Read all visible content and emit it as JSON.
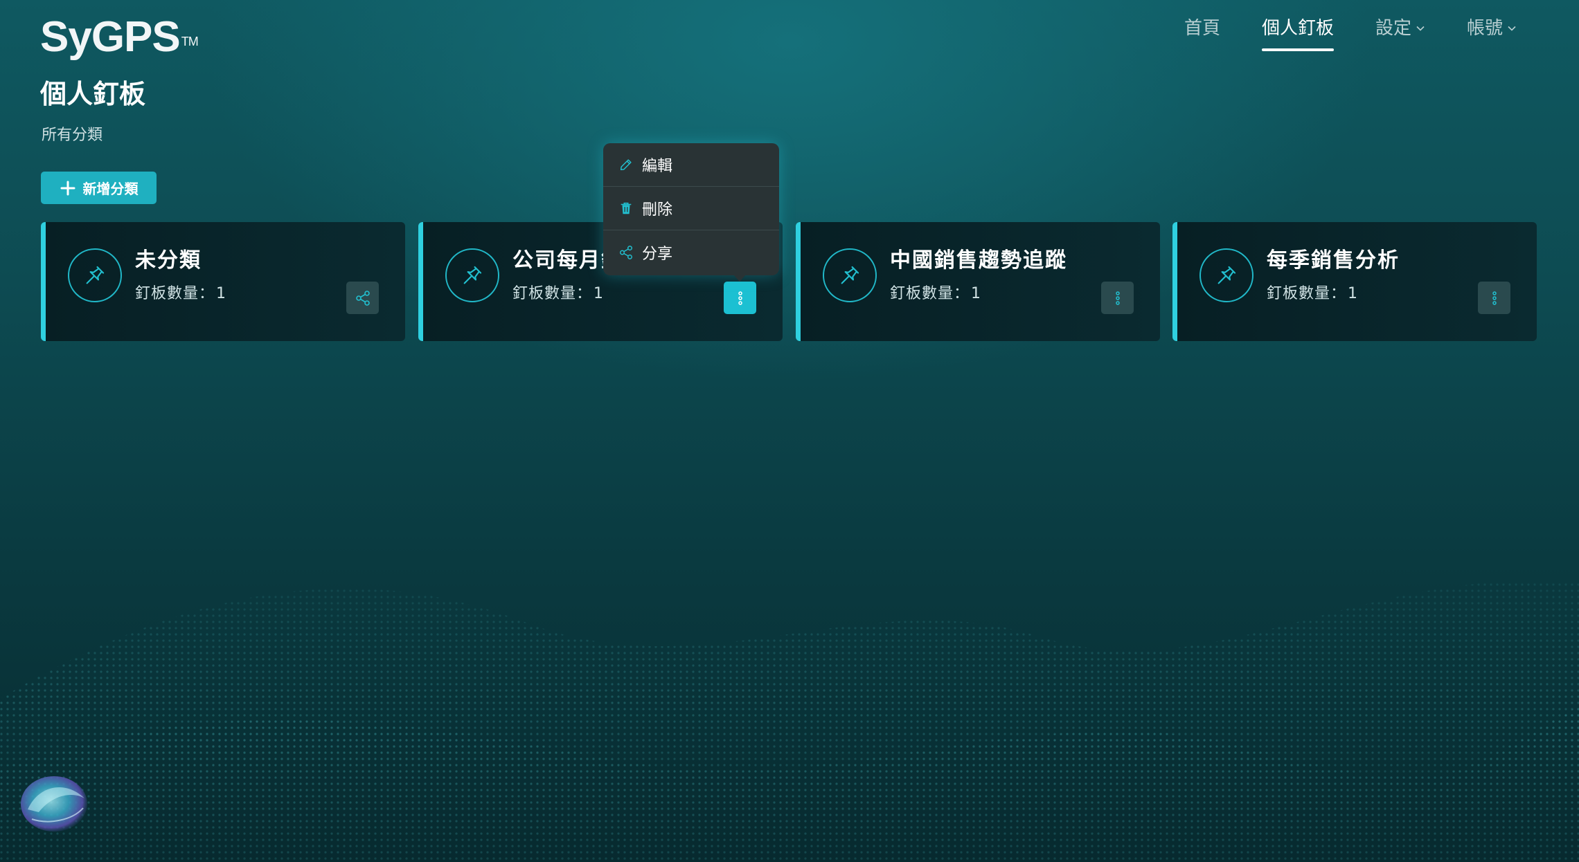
{
  "header": {
    "logo_text": "SyGPS",
    "logo_tm": "TM",
    "nav": [
      {
        "label": "首頁",
        "active": false,
        "dropdown": false
      },
      {
        "label": "個人釘板",
        "active": true,
        "dropdown": false
      },
      {
        "label": "設定",
        "active": false,
        "dropdown": true
      },
      {
        "label": "帳號",
        "active": false,
        "dropdown": true
      }
    ]
  },
  "page": {
    "title": "個人釘板",
    "breadcrumb": "所有分類",
    "add_button_label": "新增分類"
  },
  "cards": [
    {
      "title": "未分類",
      "count_label": "釘板數量：",
      "count": "1",
      "action_icon": "share-icon"
    },
    {
      "title": "公司每月銷售",
      "count_label": "釘板數量：",
      "count": "1",
      "action_icon": "more-vertical-icon"
    },
    {
      "title": "中國銷售趨勢追蹤",
      "count_label": "釘板數量：",
      "count": "1",
      "action_icon": "more-vertical-icon"
    },
    {
      "title": "每季銷售分析",
      "count_label": "釘板數量：",
      "count": "1",
      "action_icon": "more-vertical-icon"
    }
  ],
  "context_menu": {
    "items": [
      {
        "label": "編輯",
        "icon": "edit-icon"
      },
      {
        "label": "刪除",
        "icon": "trash-icon"
      },
      {
        "label": "分享",
        "icon": "share-icon"
      }
    ]
  },
  "colors": {
    "accent": "#1fb0c0",
    "accent_bright": "#2fd0e0",
    "card_bg": "#071f24",
    "menu_bg": "#293335",
    "page_bg_top": "#0f5961"
  }
}
